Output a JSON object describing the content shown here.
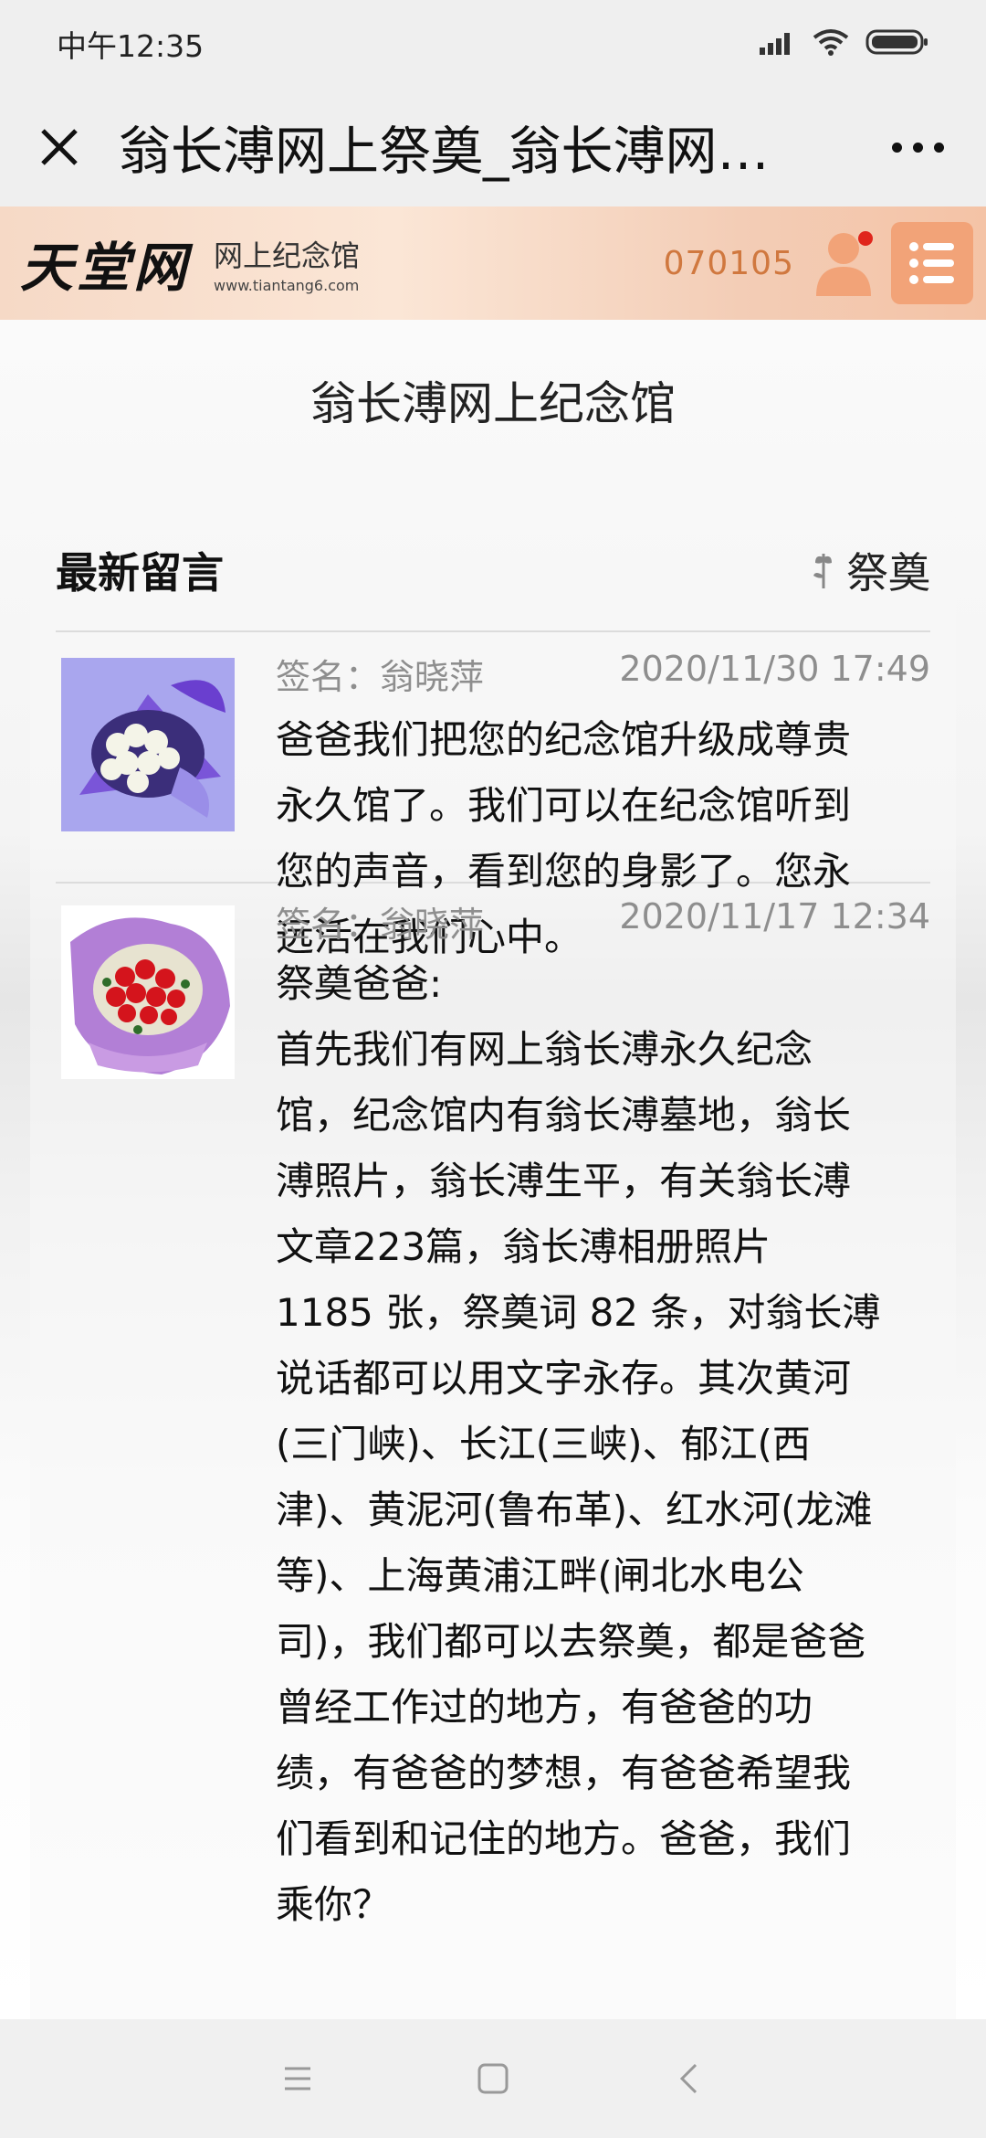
{
  "status_bar": {
    "time": "中午12:35"
  },
  "title_bar": {
    "title": "翁长溥网上祭奠_翁长溥网…"
  },
  "site_header": {
    "logo_text": "天堂网",
    "logo_subtitle": "网上纪念馆",
    "logo_url": "www.tiantang6.com",
    "visitor_count": "070105"
  },
  "memorial_title": "翁长溥网上纪念馆",
  "messages_section": {
    "heading": "最新留言",
    "tribute_label": "祭奠"
  },
  "messages": [
    {
      "signature_label": "签名：",
      "signature_name": "翁晓萍",
      "date": "2020/11/30 17:49",
      "text": "爸爸我们把您的纪念馆升级成尊贵\n永久馆了。我们可以在纪念馆听到\n您的声音，看到您的身影了。您永\n远活在我们心中。",
      "flower_image": "white-rose-bouquet"
    },
    {
      "signature_label": "签名：",
      "signature_name": "翁晓萍",
      "date": "2020/11/17 12:34",
      "text": "祭奠爸爸:\n首先我们有网上翁长溥永久纪念\n馆，纪念馆内有翁长溥墓地，翁长\n溥照片，翁长溥生平，有关翁长溥\n文章223篇，翁长溥相册照片\n1185 张，祭奠词  82 条，对翁长溥\n说话都可以用文字永存。其次黄河\n(三门峡)、长江(三峡)、郁江(西\n津)、黄泥河(鲁布革)、红水河(龙滩\n等)、上海黄浦江畔(闸北水电公\n司)，我们都可以去祭奠，都是爸爸\n曾经工作过的地方，有爸爸的功\n绩，有爸爸的梦想，有爸爸希望我\n们看到和记住的地方。爸爸，我们\n乘你？",
      "flower_image": "red-rose-bouquet"
    }
  ],
  "colors": {
    "header_accent": "#d0783f",
    "menu_button": "#f2a378",
    "notification_dot": "#e0261c"
  },
  "icons": [
    "signal-icon",
    "wifi-icon",
    "battery-icon",
    "close-icon",
    "more-icon",
    "user-icon",
    "menu-icon",
    "tribute-flower-icon",
    "nav-menu-icon",
    "nav-home-icon",
    "nav-back-icon"
  ]
}
